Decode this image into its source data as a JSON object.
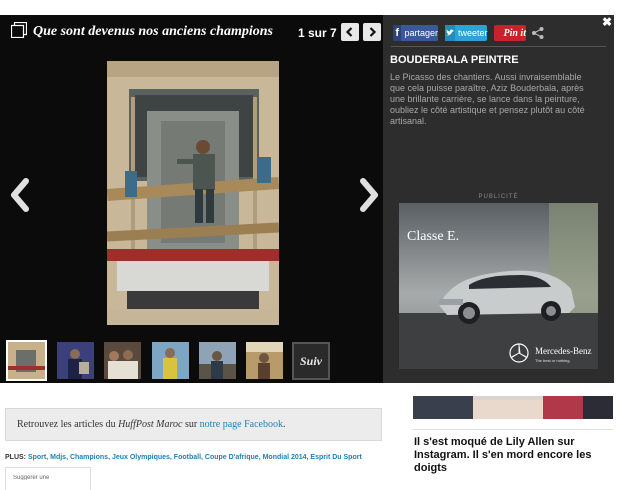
{
  "slideshow": {
    "title": "Que sont devenus nos anciens champions",
    "counter": "1 sur 7",
    "next_thumb_label": "Suiv",
    "icons": {
      "gallery": "gallery-icon",
      "prev": "chevron-left-icon",
      "next": "chevron-right-icon",
      "close": "close-icon",
      "share": "share-icon"
    },
    "thumbnails": [
      {
        "name": "thumb-1",
        "active": true
      },
      {
        "name": "thumb-2",
        "active": false
      },
      {
        "name": "thumb-3",
        "active": false
      },
      {
        "name": "thumb-4",
        "active": false
      },
      {
        "name": "thumb-5",
        "active": false
      },
      {
        "name": "thumb-6",
        "active": false
      }
    ]
  },
  "share": {
    "facebook_label": "partager",
    "twitter_label": "tweeter",
    "pinterest_label": "Pin it",
    "colors": {
      "facebook": "#3b5998",
      "twitter": "#2fa3d6",
      "pinterest": "#c8232c"
    }
  },
  "caption": {
    "title": "BOUDERBALA PEINTRE",
    "text": "Le Picasso des chantiers. Aussi invraisemblable que cela puisse paraître, Aziz Bouderbala, après une brillante carrière, se lance dans la peinture, oubliez le côté artistique et pensez plutôt au côté artisanal."
  },
  "ad": {
    "label": "PUBLICITÉ",
    "headline": "Classe E.",
    "brand": "Mercedes-Benz",
    "tagline": "The best or nothing."
  },
  "facebook_promo": {
    "prefix": "Retrouvez les articles du ",
    "publication": "HuffPost Maroc",
    "middle": " sur ",
    "link": "notre page Facebook",
    "suffix": "."
  },
  "plus": {
    "label": "PLUS:",
    "tags": "Sport, Mdjs, Champions, Jeux Olympiques, Football, Coupe D'afrique, Mondial 2014, Esprit Du Sport"
  },
  "sidebar": {
    "headline": "Il s'est moqué de Lily Allen sur Instagram. Il s'en mord encore les doigts"
  },
  "truncated_box_text": "Suggérer une"
}
